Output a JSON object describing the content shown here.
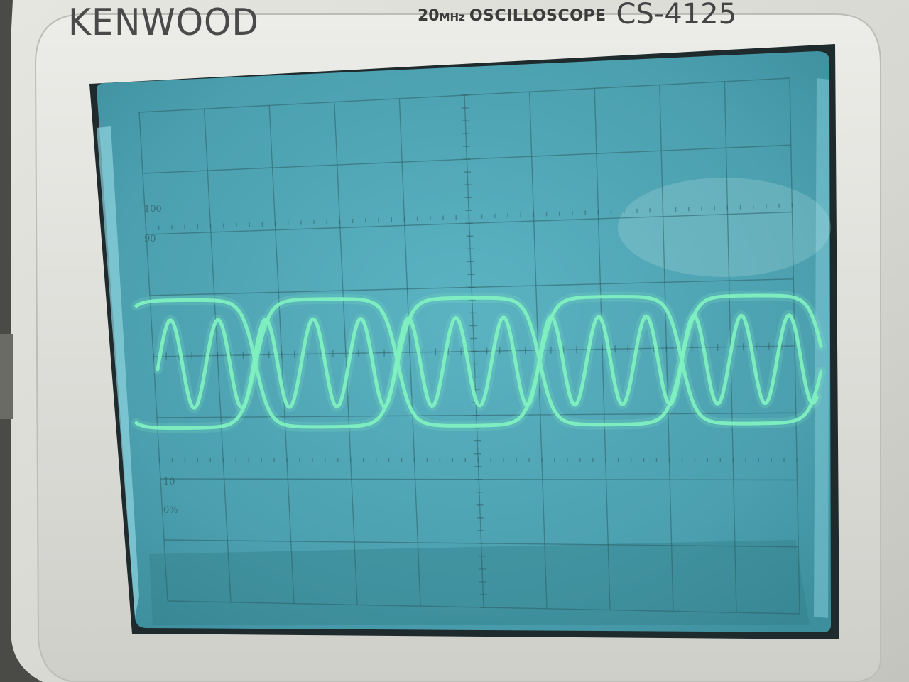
{
  "device": {
    "brand": "KENWOOD",
    "model_frequency": "20",
    "model_frequency_unit": "MHz",
    "model_type": "OSCILLOSCOPE",
    "model_code_partial": "CS-4125"
  },
  "screen": {
    "graticule_labels": {
      "top_100": "100",
      "top_90": "90",
      "bottom_10": "10",
      "bottom_0": "0%"
    }
  },
  "colors": {
    "bezel": "#dcdcd6",
    "crt": "#4fa7b6",
    "trace": "#7ff0c0"
  }
}
